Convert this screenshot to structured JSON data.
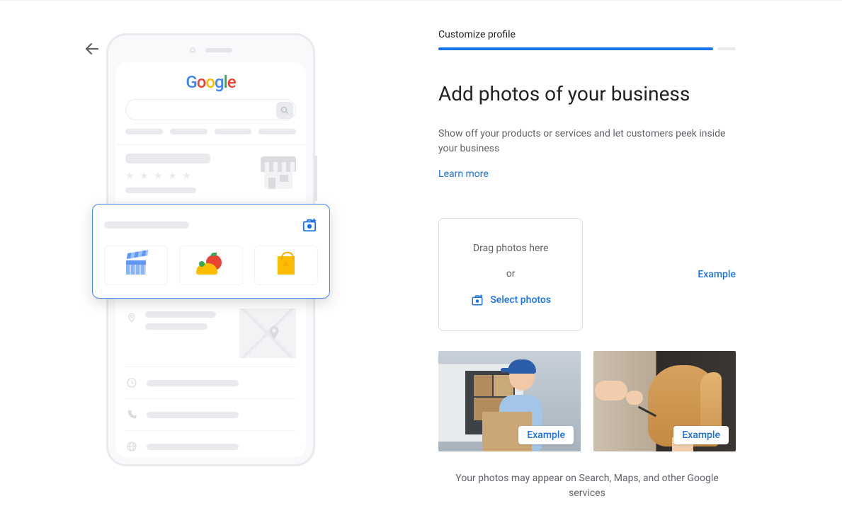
{
  "step_label": "Customize profile",
  "title": "Add photos of your business",
  "description": "Show off your products or services and let customers peek inside your business",
  "learn_more": "Learn more",
  "dropzone": {
    "drag_text": "Drag photos here",
    "or_text": "or",
    "select_text": "Select photos"
  },
  "example_label": "Example",
  "thumb1_badge": "Example",
  "thumb2_badge": "Example",
  "footer_text": "Your photos may appear on Search, Maps, and other Google services",
  "google_logo": {
    "g1": "G",
    "o1": "o",
    "o2": "o",
    "g2": "g",
    "l": "l",
    "e": "e"
  }
}
